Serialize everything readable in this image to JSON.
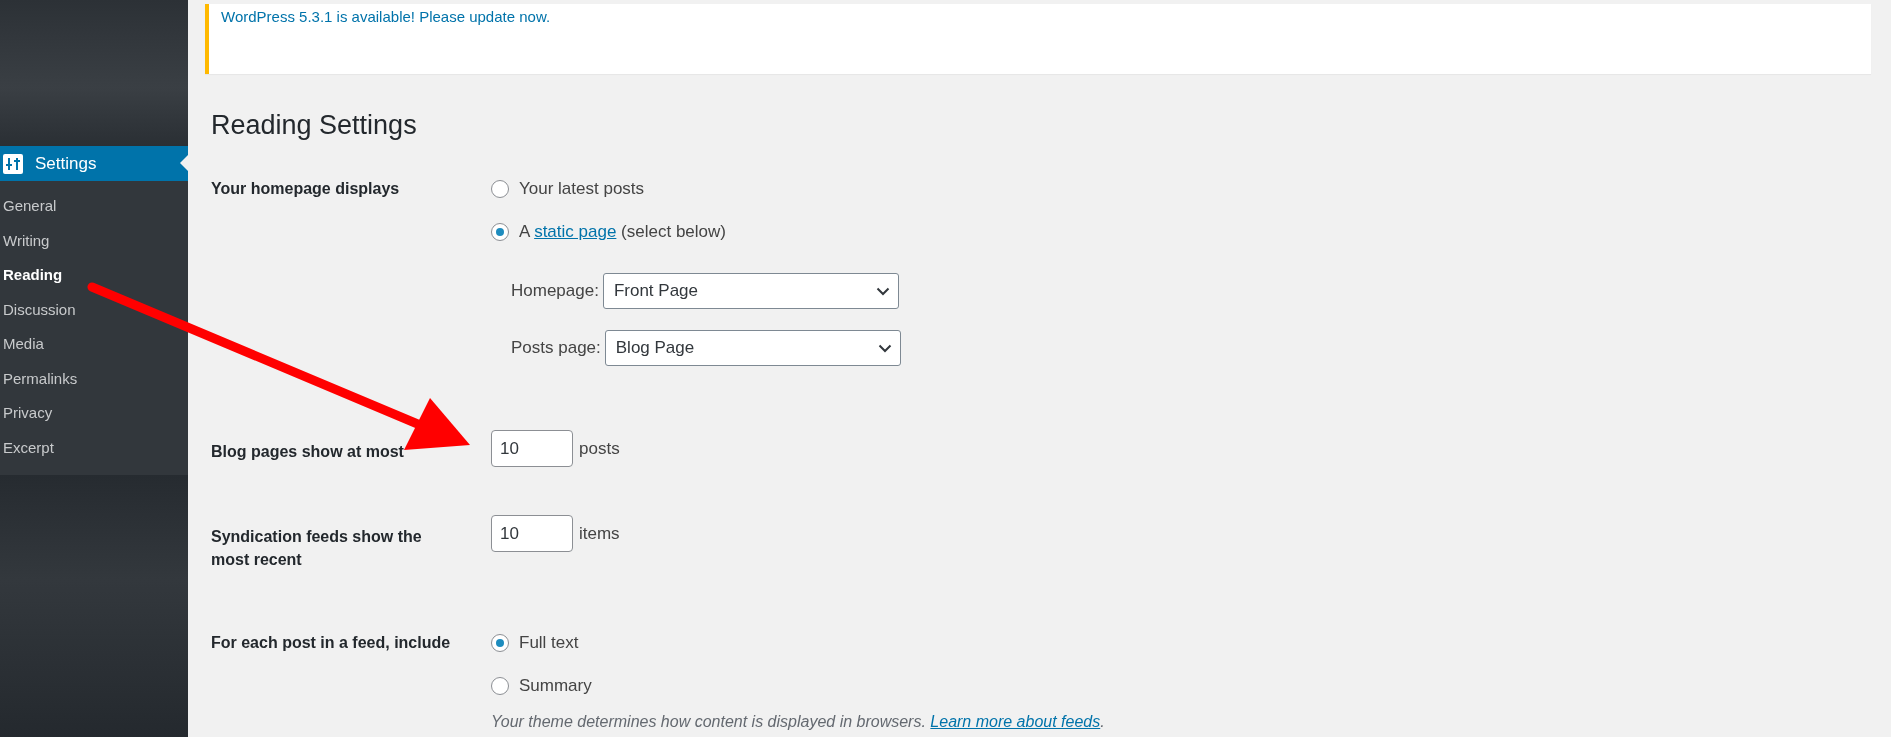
{
  "notice": {
    "text": "WordPress 5.3.1 is available!",
    "link": "Please update now."
  },
  "sidebar": {
    "menu": {
      "label": "Settings",
      "selected": true
    },
    "items": [
      {
        "label": "General",
        "selected": false
      },
      {
        "label": "Writing",
        "selected": false
      },
      {
        "label": "Reading",
        "selected": true
      },
      {
        "label": "Discussion",
        "selected": false
      },
      {
        "label": "Media",
        "selected": false
      },
      {
        "label": "Permalinks",
        "selected": false
      },
      {
        "label": "Privacy",
        "selected": false
      },
      {
        "label": "Excerpt",
        "selected": false
      }
    ]
  },
  "page_title": "Reading Settings",
  "rows": [
    {
      "kind": "radios",
      "label": "Your homepage displays",
      "options": [
        {
          "before": "Your latest posts",
          "selected": false
        },
        {
          "before": "A",
          "link": "static page",
          "after": "(select below)",
          "selected": true
        }
      ],
      "selects": [
        {
          "label": "Homepage:",
          "value": "Front Page"
        },
        {
          "label": "Posts page:",
          "value": "Blog Page"
        }
      ]
    },
    {
      "kind": "number",
      "label": "Blog pages show at most",
      "value": "10",
      "unit": "posts"
    },
    {
      "kind": "number",
      "label": "Syndication feeds show the most recent",
      "value": "10",
      "unit": "items"
    },
    {
      "kind": "radios",
      "label": "For each post in a feed, include",
      "options": [
        {
          "before": "Full text",
          "selected": true
        },
        {
          "before": "Summary",
          "selected": false
        }
      ],
      "hint": {
        "text": "Your theme determines how content is displayed in browsers.",
        "link": "Learn more about feeds",
        "after": "."
      }
    }
  ]
}
